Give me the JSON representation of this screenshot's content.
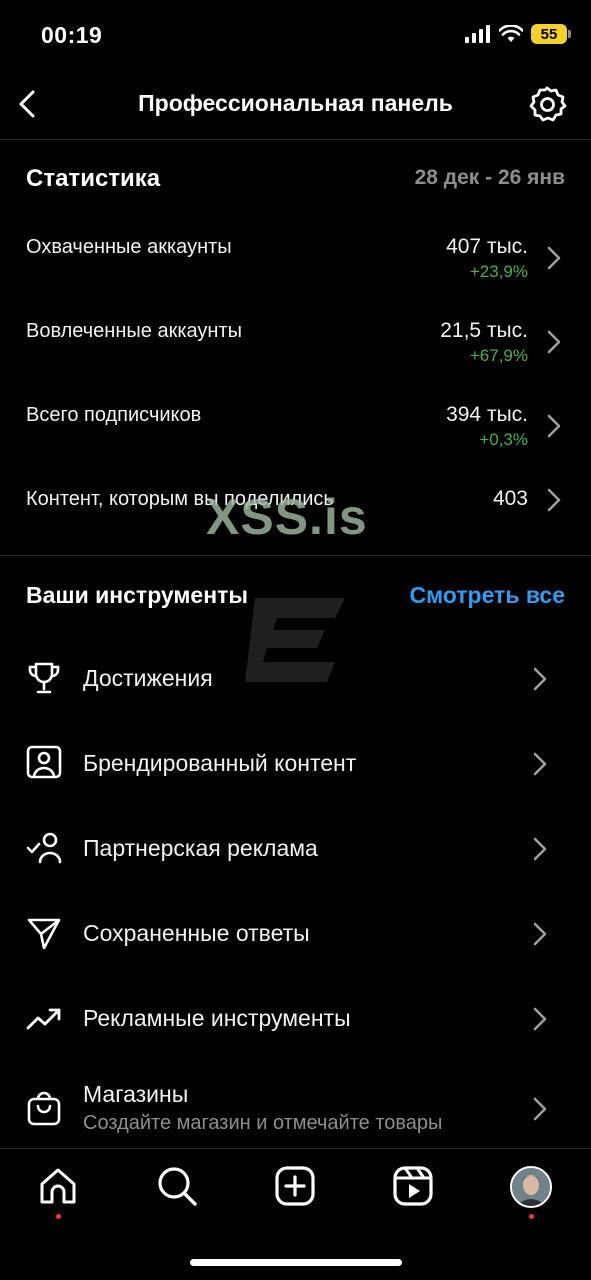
{
  "status_bar": {
    "time": "00:19",
    "battery": "55"
  },
  "header": {
    "title": "Профессиональная панель"
  },
  "stats": {
    "title": "Статистика",
    "range": "28 дек - 26 янв",
    "rows": [
      {
        "label": "Охваченные аккаунты",
        "value": "407 тыс.",
        "delta": "+23,9%"
      },
      {
        "label": "Вовлеченные аккаунты",
        "value": "21,5 тыс.",
        "delta": "+67,9%"
      },
      {
        "label": "Всего подписчиков",
        "value": "394 тыс.",
        "delta": "+0,3%"
      },
      {
        "label": "Контент, которым вы поделились",
        "value": "403"
      }
    ]
  },
  "tools": {
    "title": "Ваши инструменты",
    "see_all": "Смотреть все",
    "items": [
      {
        "label": "Достижения",
        "icon": "trophy-icon"
      },
      {
        "label": "Брендированный контент",
        "icon": "branded-content-icon"
      },
      {
        "label": "Партнерская реклама",
        "icon": "partner-ads-icon"
      },
      {
        "label": "Сохраненные ответы",
        "icon": "paper-plane-icon"
      },
      {
        "label": "Рекламные инструменты",
        "icon": "trending-up-icon"
      },
      {
        "label": "Магазины",
        "sub": "Создайте магазин и отмечайте товары",
        "icon": "shopping-bag-icon"
      }
    ]
  },
  "watermark": {
    "text": "XSS.is"
  },
  "colors": {
    "accent": "#2f9cf4",
    "positive": "#43b34b",
    "muted": "#8e8e8e",
    "notification": "#ff3040"
  }
}
